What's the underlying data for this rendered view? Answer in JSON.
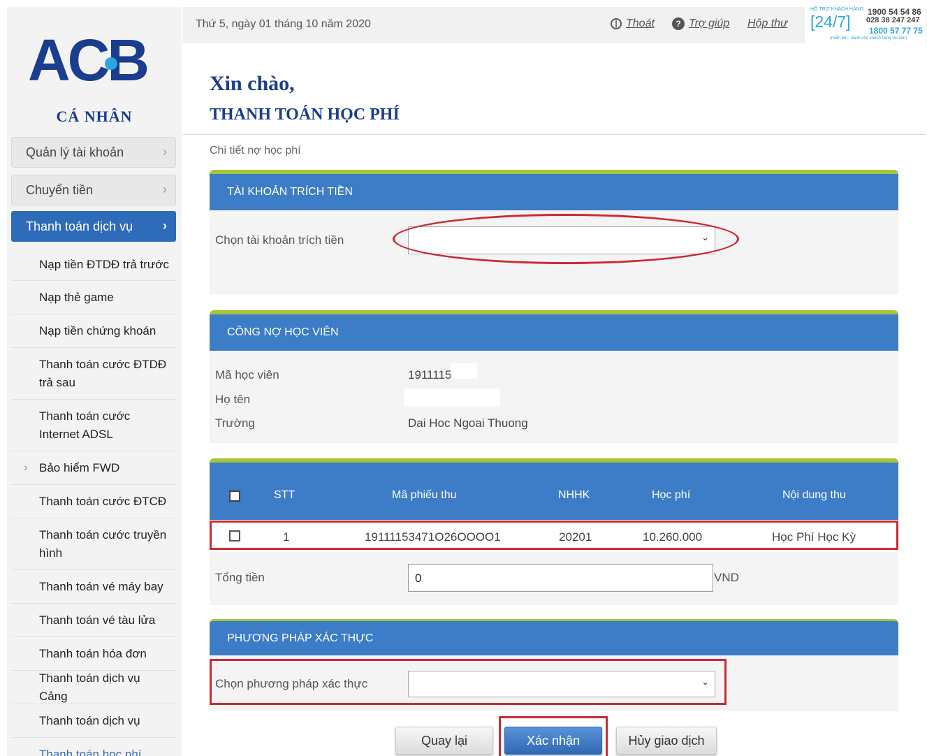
{
  "brand": {
    "logo_text": "ACB",
    "section_label": "CÁ NHÂN",
    "colors": {
      "navy": "#1a3d8f",
      "accent_blue": "#3d7cc7",
      "accent_green": "#a6c63a",
      "highlight_red": "#cc2a36"
    }
  },
  "sidebar": {
    "top_items": [
      {
        "label": "Quản lý tài khoản",
        "icon": "chevron-right-icon"
      },
      {
        "label": "Chuyển tiền",
        "icon": "chevron-right-icon"
      },
      {
        "label": "Thanh toán dịch vụ",
        "icon": "chevron-right-icon",
        "active": true
      }
    ],
    "sub_items": [
      {
        "label": "Nạp tiền ĐTDĐ trả trước"
      },
      {
        "label": "Nạp thẻ game"
      },
      {
        "label": "Nạp tiền chứng khoán"
      },
      {
        "label": "Thanh toán cước ĐTDĐ trả sau"
      },
      {
        "label": "Thanh toán cước Internet ADSL"
      },
      {
        "label": "Bảo hiểm FWD",
        "expandable": true
      },
      {
        "label": "Thanh toán cước ĐTCĐ"
      },
      {
        "label": "Thanh toán cước truyền hình"
      },
      {
        "label": "Thanh toán vé máy bay"
      },
      {
        "label": "Thanh toán vé tàu lửa"
      },
      {
        "label": "Thanh toán hóa đơn"
      },
      {
        "label": "Thanh toán dịch vụ Cảng"
      },
      {
        "label": "Thanh toán dịch vụ"
      },
      {
        "label": "Thanh toán học phí",
        "current": true
      }
    ]
  },
  "header": {
    "date": "Thứ 5, ngày 01 tháng 10 năm 2020",
    "logout_label": "Thoát",
    "help_label": "Trợ giúp",
    "inbox_label": "Hộp thư",
    "hotline": {
      "caption": "HỖ TRỢ KHÁCH HÀNG",
      "badge": "[24/7]",
      "number_1": "1900 54 54 86",
      "number_2": "028 38 247 247",
      "number_3": "1800 57 77 75",
      "free_note": "(miễn phí - dành cho khách hàng ưu tiên)"
    }
  },
  "main": {
    "greeting": "Xin chào,",
    "title": "THANH TOÁN HỌC PHÍ",
    "breadcrumb": "Chi tiết nợ học phí",
    "debit_account": {
      "heading": "TÀI KHOẢN TRÍCH TIỀN",
      "label": "Chọn tài khoản trích tiền",
      "selected": ""
    },
    "student_debt": {
      "heading": "CÔNG NỢ HỌC VIÊN",
      "student_id_label": "Mã học viên",
      "student_id_value": "1911115",
      "name_label": "Họ tên",
      "name_value": "",
      "school_label": "Trường",
      "school_value": "Dai Hoc Ngoai Thuong"
    },
    "fee_table": {
      "columns": [
        "STT",
        "Mã phiếu thu",
        "NHHK",
        "Học phí",
        "Nội dung thu"
      ],
      "rows": [
        {
          "stt": "1",
          "receipt_code": "19111153471O26OOOO1",
          "term": "20201",
          "fee": "10.260.000",
          "content": "Học Phí Học Kỳ"
        }
      ]
    },
    "total": {
      "label": "Tổng tiền",
      "value": "0",
      "unit": "VND"
    },
    "auth": {
      "heading": "PHƯƠNG PHÁP XÁC THỰC",
      "label": "Chọn phương pháp xác thực",
      "selected": ""
    },
    "buttons": {
      "back": "Quay lại",
      "confirm": "Xác nhận",
      "cancel": "Hủy giao dịch"
    }
  }
}
